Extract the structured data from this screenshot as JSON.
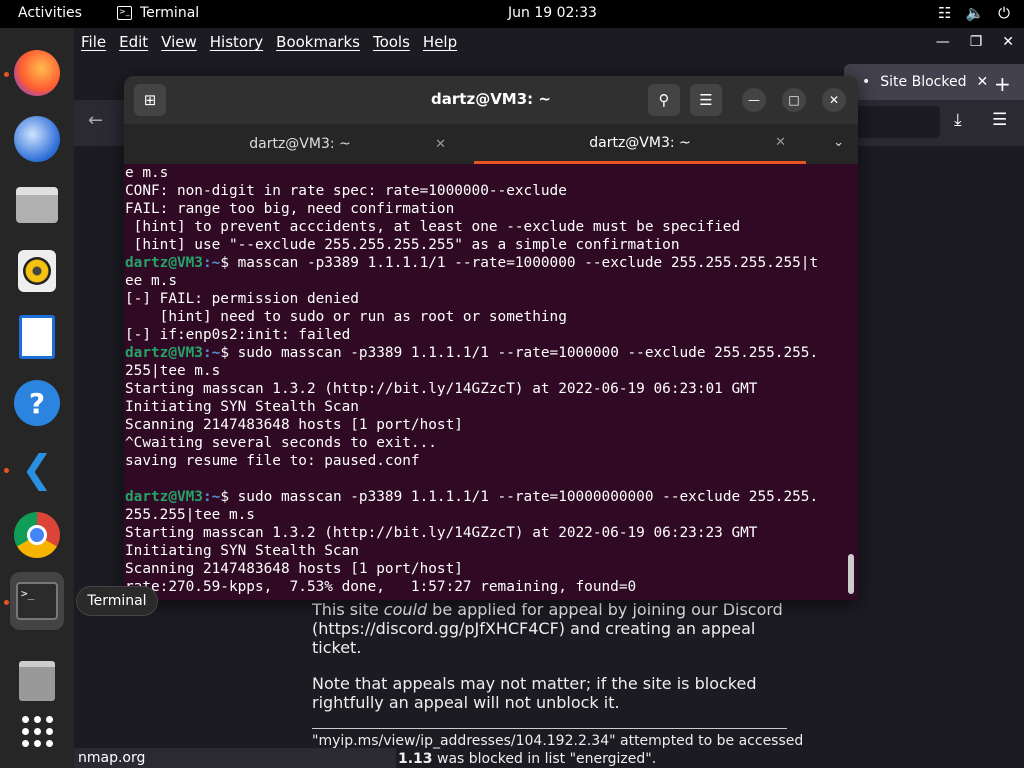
{
  "topbar": {
    "activities": "Activities",
    "app": "Terminal",
    "clock": "Jun 19  02:33"
  },
  "dock": {
    "tooltip": "Terminal"
  },
  "firefox": {
    "menus": [
      "File",
      "Edit",
      "View",
      "History",
      "Bookmarks",
      "Tools",
      "Help"
    ],
    "active_tab": "Site Blocked",
    "content": {
      "p1_pre": "This site ",
      "p1_em": "could",
      "p1_post": " be applied for appeal by joining our Discord (https://discord.gg/pJfXHCF4CF) and creating an appeal ticket.",
      "p2": "Note that appeals may not matter; if the site is blocked rightfully an appeal will not unblock it.",
      "footer1": "\"myip.ms/view/ip_addresses/104.192.2.34\" attempted to be accessed",
      "footer2_bold": "1.13",
      "footer2_rest": " was blocked in list \"energized\"."
    },
    "status_url": "nmap.org"
  },
  "terminal": {
    "title": "dartz@VM3: ~",
    "tabs": [
      {
        "label": "dartz@VM3: ~"
      },
      {
        "label": "dartz@VM3: ~"
      }
    ],
    "prompt_user": "dartz@VM3",
    "prompt_path": ":~",
    "lines": [
      {
        "t": "e m.s"
      },
      {
        "t": "CONF: non-digit in rate spec: rate=1000000--exclude"
      },
      {
        "t": "FAIL: range too big, need confirmation"
      },
      {
        "t": " [hint] to prevent acccidents, at least one --exclude must be specified"
      },
      {
        "t": " [hint] use \"--exclude 255.255.255.255\" as a simple confirmation"
      },
      {
        "p": true,
        "t": "$ masscan -p3389 1.1.1.1/1 --rate=1000000 --exclude 255.255.255.255|t"
      },
      {
        "t": "ee m.s"
      },
      {
        "t": "[-] FAIL: permission denied"
      },
      {
        "t": "    [hint] need to sudo or run as root or something"
      },
      {
        "t": "[-] if:enp0s2:init: failed"
      },
      {
        "p": true,
        "t": "$ sudo masscan -p3389 1.1.1.1/1 --rate=1000000 --exclude 255.255.255."
      },
      {
        "t": "255|tee m.s"
      },
      {
        "t": "Starting masscan 1.3.2 (http://bit.ly/14GZzcT) at 2022-06-19 06:23:01 GMT"
      },
      {
        "t": "Initiating SYN Stealth Scan"
      },
      {
        "t": "Scanning 2147483648 hosts [1 port/host]"
      },
      {
        "t": "^Cwaiting several seconds to exit..."
      },
      {
        "t": "saving resume file to: paused.conf"
      },
      {
        "t": ""
      },
      {
        "p": true,
        "t": "$ sudo masscan -p3389 1.1.1.1/1 --rate=10000000000 --exclude 255.255."
      },
      {
        "t": "255.255|tee m.s"
      },
      {
        "t": "Starting masscan 1.3.2 (http://bit.ly/14GZzcT) at 2022-06-19 06:23:23 GMT"
      },
      {
        "t": "Initiating SYN Stealth Scan"
      },
      {
        "t": "Scanning 2147483648 hosts [1 port/host]"
      },
      {
        "t": "rate:270.59-kpps,  7.53% done,   1:57:27 remaining, found=0"
      }
    ]
  }
}
